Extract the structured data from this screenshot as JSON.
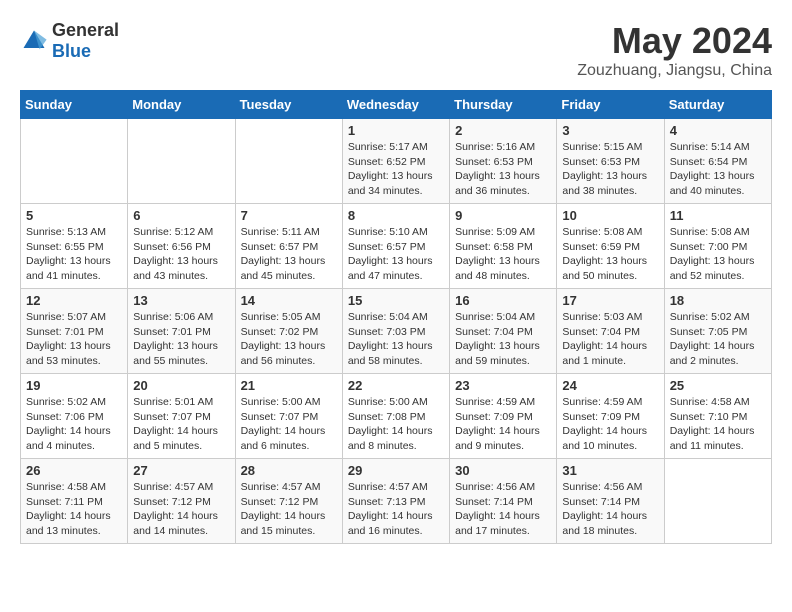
{
  "header": {
    "logo_general": "General",
    "logo_blue": "Blue",
    "title": "May 2024",
    "location": "Zouzhuang, Jiangsu, China"
  },
  "calendar": {
    "days_of_week": [
      "Sunday",
      "Monday",
      "Tuesday",
      "Wednesday",
      "Thursday",
      "Friday",
      "Saturday"
    ],
    "weeks": [
      [
        {
          "day": "",
          "info": ""
        },
        {
          "day": "",
          "info": ""
        },
        {
          "day": "",
          "info": ""
        },
        {
          "day": "1",
          "info": "Sunrise: 5:17 AM\nSunset: 6:52 PM\nDaylight: 13 hours\nand 34 minutes."
        },
        {
          "day": "2",
          "info": "Sunrise: 5:16 AM\nSunset: 6:53 PM\nDaylight: 13 hours\nand 36 minutes."
        },
        {
          "day": "3",
          "info": "Sunrise: 5:15 AM\nSunset: 6:53 PM\nDaylight: 13 hours\nand 38 minutes."
        },
        {
          "day": "4",
          "info": "Sunrise: 5:14 AM\nSunset: 6:54 PM\nDaylight: 13 hours\nand 40 minutes."
        }
      ],
      [
        {
          "day": "5",
          "info": "Sunrise: 5:13 AM\nSunset: 6:55 PM\nDaylight: 13 hours\nand 41 minutes."
        },
        {
          "day": "6",
          "info": "Sunrise: 5:12 AM\nSunset: 6:56 PM\nDaylight: 13 hours\nand 43 minutes."
        },
        {
          "day": "7",
          "info": "Sunrise: 5:11 AM\nSunset: 6:57 PM\nDaylight: 13 hours\nand 45 minutes."
        },
        {
          "day": "8",
          "info": "Sunrise: 5:10 AM\nSunset: 6:57 PM\nDaylight: 13 hours\nand 47 minutes."
        },
        {
          "day": "9",
          "info": "Sunrise: 5:09 AM\nSunset: 6:58 PM\nDaylight: 13 hours\nand 48 minutes."
        },
        {
          "day": "10",
          "info": "Sunrise: 5:08 AM\nSunset: 6:59 PM\nDaylight: 13 hours\nand 50 minutes."
        },
        {
          "day": "11",
          "info": "Sunrise: 5:08 AM\nSunset: 7:00 PM\nDaylight: 13 hours\nand 52 minutes."
        }
      ],
      [
        {
          "day": "12",
          "info": "Sunrise: 5:07 AM\nSunset: 7:01 PM\nDaylight: 13 hours\nand 53 minutes."
        },
        {
          "day": "13",
          "info": "Sunrise: 5:06 AM\nSunset: 7:01 PM\nDaylight: 13 hours\nand 55 minutes."
        },
        {
          "day": "14",
          "info": "Sunrise: 5:05 AM\nSunset: 7:02 PM\nDaylight: 13 hours\nand 56 minutes."
        },
        {
          "day": "15",
          "info": "Sunrise: 5:04 AM\nSunset: 7:03 PM\nDaylight: 13 hours\nand 58 minutes."
        },
        {
          "day": "16",
          "info": "Sunrise: 5:04 AM\nSunset: 7:04 PM\nDaylight: 13 hours\nand 59 minutes."
        },
        {
          "day": "17",
          "info": "Sunrise: 5:03 AM\nSunset: 7:04 PM\nDaylight: 14 hours\nand 1 minute."
        },
        {
          "day": "18",
          "info": "Sunrise: 5:02 AM\nSunset: 7:05 PM\nDaylight: 14 hours\nand 2 minutes."
        }
      ],
      [
        {
          "day": "19",
          "info": "Sunrise: 5:02 AM\nSunset: 7:06 PM\nDaylight: 14 hours\nand 4 minutes."
        },
        {
          "day": "20",
          "info": "Sunrise: 5:01 AM\nSunset: 7:07 PM\nDaylight: 14 hours\nand 5 minutes."
        },
        {
          "day": "21",
          "info": "Sunrise: 5:00 AM\nSunset: 7:07 PM\nDaylight: 14 hours\nand 6 minutes."
        },
        {
          "day": "22",
          "info": "Sunrise: 5:00 AM\nSunset: 7:08 PM\nDaylight: 14 hours\nand 8 minutes."
        },
        {
          "day": "23",
          "info": "Sunrise: 4:59 AM\nSunset: 7:09 PM\nDaylight: 14 hours\nand 9 minutes."
        },
        {
          "day": "24",
          "info": "Sunrise: 4:59 AM\nSunset: 7:09 PM\nDaylight: 14 hours\nand 10 minutes."
        },
        {
          "day": "25",
          "info": "Sunrise: 4:58 AM\nSunset: 7:10 PM\nDaylight: 14 hours\nand 11 minutes."
        }
      ],
      [
        {
          "day": "26",
          "info": "Sunrise: 4:58 AM\nSunset: 7:11 PM\nDaylight: 14 hours\nand 13 minutes."
        },
        {
          "day": "27",
          "info": "Sunrise: 4:57 AM\nSunset: 7:12 PM\nDaylight: 14 hours\nand 14 minutes."
        },
        {
          "day": "28",
          "info": "Sunrise: 4:57 AM\nSunset: 7:12 PM\nDaylight: 14 hours\nand 15 minutes."
        },
        {
          "day": "29",
          "info": "Sunrise: 4:57 AM\nSunset: 7:13 PM\nDaylight: 14 hours\nand 16 minutes."
        },
        {
          "day": "30",
          "info": "Sunrise: 4:56 AM\nSunset: 7:14 PM\nDaylight: 14 hours\nand 17 minutes."
        },
        {
          "day": "31",
          "info": "Sunrise: 4:56 AM\nSunset: 7:14 PM\nDaylight: 14 hours\nand 18 minutes."
        },
        {
          "day": "",
          "info": ""
        }
      ]
    ]
  }
}
